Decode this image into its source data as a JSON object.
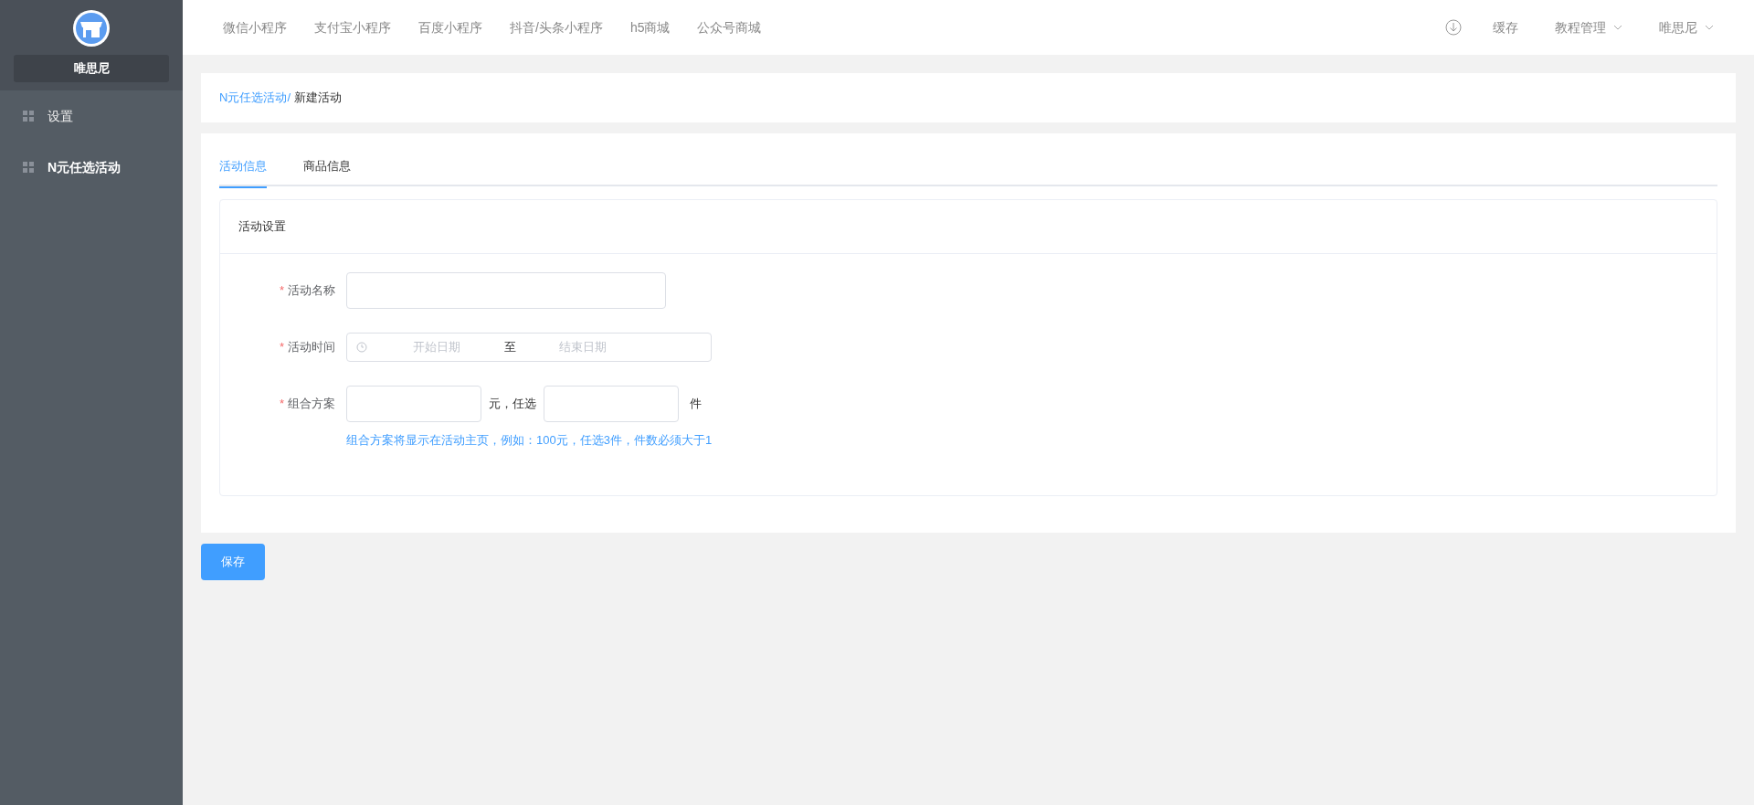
{
  "sidebar": {
    "shop_name": "唯思尼",
    "items": [
      {
        "label": "设置",
        "selected": false
      },
      {
        "label": "N元任选活动",
        "selected": true
      }
    ]
  },
  "top_nav": {
    "links": [
      "微信小程序",
      "支付宝小程序",
      "百度小程序",
      "抖音/头条小程序",
      "h5商城",
      "公众号商城"
    ],
    "cache": "缓存",
    "menus": [
      "教程管理",
      "唯思尼"
    ]
  },
  "breadcrumb": {
    "parent": "N元任选活动/",
    "current": "新建活动"
  },
  "tabs": [
    {
      "label": "活动信息",
      "selected": true
    },
    {
      "label": "商品信息",
      "selected": false
    }
  ],
  "section_title": "活动设置",
  "form": {
    "required_mark": "*",
    "name_label": "活动名称",
    "time_label": "活动时间",
    "start_placeholder": "开始日期",
    "separator": "至",
    "end_placeholder": "结束日期",
    "combo_label": "组合方案",
    "yuan_text": "元，任选",
    "piece_text": "件",
    "hint": "组合方案将显示在活动主页，例如：100元，任选3件，件数必须大于1"
  },
  "save_button": "保存"
}
